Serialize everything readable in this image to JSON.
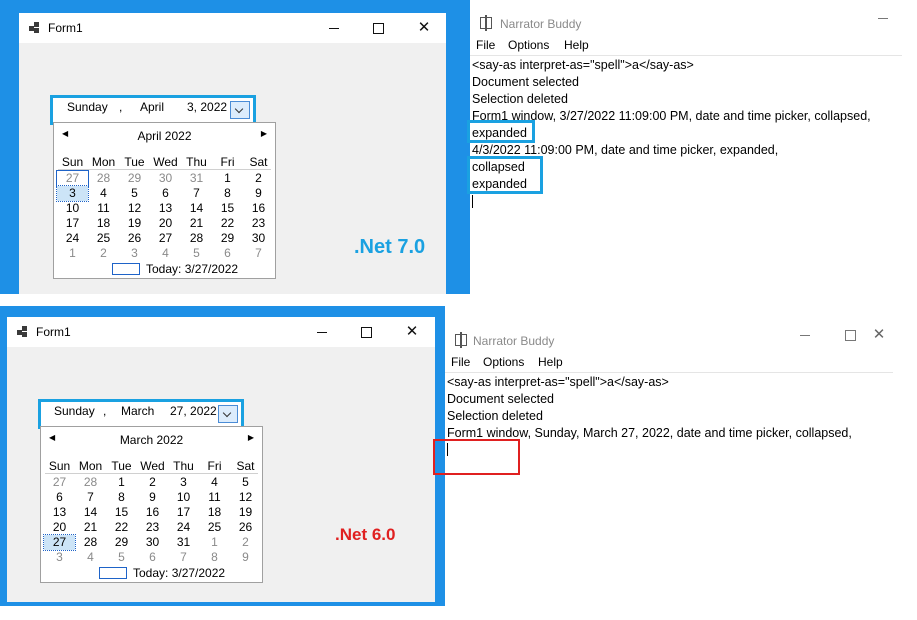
{
  "top": {
    "form": {
      "title": "Form1",
      "dtp": {
        "day": "Sunday",
        "sep": ",",
        "month": "April",
        "date": "3, 2022"
      },
      "calendar": {
        "month_label": "April 2022",
        "dow": [
          "Sun",
          "Mon",
          "Tue",
          "Wed",
          "Thu",
          "Fri",
          "Sat"
        ],
        "weeks": [
          [
            "27",
            "28",
            "29",
            "30",
            "31",
            "1",
            "2"
          ],
          [
            "3",
            "4",
            "5",
            "6",
            "7",
            "8",
            "9"
          ],
          [
            "10",
            "11",
            "12",
            "13",
            "14",
            "15",
            "16"
          ],
          [
            "17",
            "18",
            "19",
            "20",
            "21",
            "22",
            "23"
          ],
          [
            "24",
            "25",
            "26",
            "27",
            "28",
            "29",
            "30"
          ],
          [
            "1",
            "2",
            "3",
            "4",
            "5",
            "6",
            "7"
          ]
        ],
        "today_text": "Today: 3/27/2022"
      }
    },
    "net_label": ".Net 7.0",
    "net_color": "#1aa1e1",
    "narrator": {
      "title": "Narrator Buddy",
      "menu": [
        "File",
        "Options",
        "Help"
      ],
      "lines": [
        "<say-as interpret-as=\"spell\">a</say-as>",
        "Document selected",
        "Selection deleted",
        "Form1 window, 3/27/2022 11:09:00 PM, date and time picker, collapsed,",
        "expanded",
        "4/3/2022 11:09:00 PM, date and time picker, expanded,",
        "collapsed",
        "expanded"
      ]
    }
  },
  "bottom": {
    "form": {
      "title": "Form1",
      "dtp": {
        "day": "Sunday",
        "sep": ",",
        "month": "March",
        "date": "27, 2022"
      },
      "calendar": {
        "month_label": "March 2022",
        "dow": [
          "Sun",
          "Mon",
          "Tue",
          "Wed",
          "Thu",
          "Fri",
          "Sat"
        ],
        "weeks": [
          [
            "27",
            "28",
            "1",
            "2",
            "3",
            "4",
            "5"
          ],
          [
            "6",
            "7",
            "8",
            "9",
            "10",
            "11",
            "12"
          ],
          [
            "13",
            "14",
            "15",
            "16",
            "17",
            "18",
            "19"
          ],
          [
            "20",
            "21",
            "22",
            "23",
            "24",
            "25",
            "26"
          ],
          [
            "27",
            "28",
            "29",
            "30",
            "31",
            "1",
            "2"
          ],
          [
            "3",
            "4",
            "5",
            "6",
            "7",
            "8",
            "9"
          ]
        ],
        "today_text": "Today: 3/27/2022"
      }
    },
    "net_label": ".Net 6.0",
    "net_color": "#e02020",
    "narrator": {
      "title": "Narrator Buddy",
      "menu": [
        "File",
        "Options",
        "Help"
      ],
      "lines": [
        "<say-as interpret-as=\"spell\">a</say-as>",
        "Document selected",
        "Selection deleted",
        "Form1 window, Sunday, March 27, 2022, date and time picker, collapsed,"
      ]
    }
  },
  "caption_buttons": {
    "min": "",
    "max": "",
    "close": "✕"
  },
  "colors": {
    "desktop": "#1e90e6",
    "blue_highlight": "#1aa1e1",
    "red_highlight": "#e02020"
  }
}
